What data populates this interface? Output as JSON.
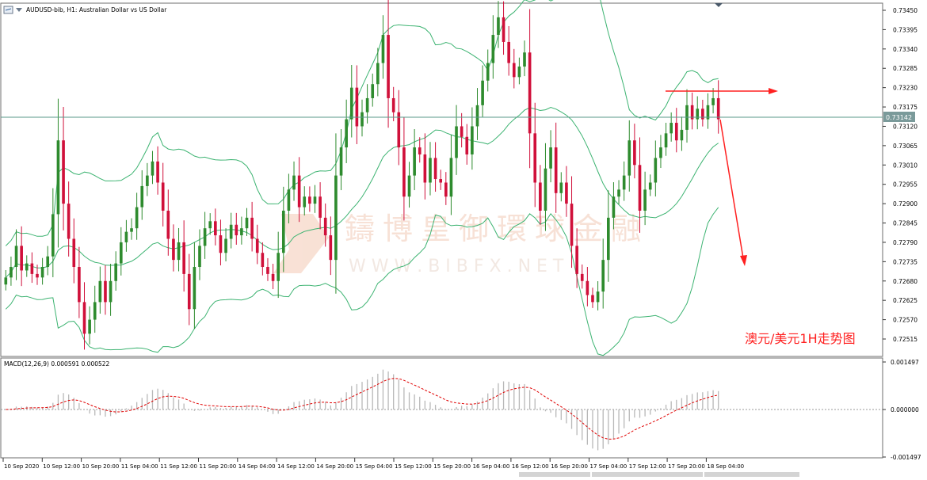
{
  "colors": {
    "bull": "#2e8b2e",
    "bear": "#d0103a",
    "band": "#3cb371",
    "macd_hist": "#b8b8b8",
    "signal": "#e00000",
    "arrow": "#ff2020",
    "price_line": "#5a9a8a",
    "grid_text": "#000000",
    "watermark": "#f3d6c8"
  },
  "header": {
    "title": "AUDUSD-bib, H1:  Australian Dollar vs US Dollar"
  },
  "macd_label": "MACD(12,26,9) 0.000591 0.000522",
  "current_price": "0.73142",
  "annotation": "澳元/美元1H走势图",
  "watermark": {
    "cn": "鑄博皇御環球金融",
    "en": "W W W . B I B F X . N E T"
  },
  "chart_data": [
    {
      "type": "candlestick",
      "title": "AUDUSD-bib, H1:  Australian Dollar vs US Dollar",
      "ylim": [
        0.72475,
        0.7347
      ],
      "yticks": [
        "0.73450",
        "0.73395",
        "0.73340",
        "0.73285",
        "0.73230",
        "0.73175",
        "0.73120",
        "0.73065",
        "0.73010",
        "0.72955",
        "0.72900",
        "0.72845",
        "0.72790",
        "0.72735",
        "0.72680",
        "0.72625",
        "0.72570",
        "0.72515"
      ],
      "xtick_labels": [
        "10 Sep 2020",
        "10 Sep 12:00",
        "10 Sep 20:00",
        "11 Sep 04:00",
        "11 Sep 12:00",
        "11 Sep 20:00",
        "14 Sep 04:00",
        "14 Sep 12:00",
        "14 Sep 20:00",
        "15 Sep 04:00",
        "15 Sep 12:00",
        "15 Sep 20:00",
        "16 Sep 04:00",
        "16 Sep 12:00",
        "16 Sep 20:00",
        "17 Sep 04:00",
        "17 Sep 12:00",
        "17 Sep 20:00",
        "18 Sep 04:00"
      ],
      "close": [
        0.7269,
        0.7272,
        0.7278,
        0.7271,
        0.7273,
        0.727,
        0.7269,
        0.7272,
        0.7275,
        0.7287,
        0.7308,
        0.729,
        0.728,
        0.7272,
        0.7262,
        0.7253,
        0.7257,
        0.7262,
        0.7268,
        0.7262,
        0.7268,
        0.7273,
        0.7279,
        0.7282,
        0.7283,
        0.7289,
        0.7295,
        0.7298,
        0.7302,
        0.7296,
        0.7288,
        0.728,
        0.7274,
        0.7279,
        0.727,
        0.726,
        0.7272,
        0.7278,
        0.7283,
        0.7285,
        0.7281,
        0.7276,
        0.728,
        0.7284,
        0.7281,
        0.7283,
        0.7286,
        0.728,
        0.7276,
        0.7272,
        0.727,
        0.7268,
        0.7276,
        0.7288,
        0.7294,
        0.7298,
        0.7289,
        0.7292,
        0.729,
        0.7292,
        0.7286,
        0.7281,
        0.7274,
        0.7298,
        0.7306,
        0.7314,
        0.7323,
        0.7312,
        0.7316,
        0.732,
        0.7324,
        0.733,
        0.7338,
        0.732,
        0.7316,
        0.7306,
        0.7292,
        0.7298,
        0.7306,
        0.7304,
        0.7296,
        0.7303,
        0.7297,
        0.7296,
        0.7292,
        0.7303,
        0.7312,
        0.7309,
        0.7304,
        0.7312,
        0.7318,
        0.7325,
        0.733,
        0.7338,
        0.7343,
        0.7336,
        0.733,
        0.7326,
        0.7329,
        0.7333,
        0.731,
        0.7296,
        0.7288,
        0.73,
        0.7306,
        0.7293,
        0.7296,
        0.729,
        0.7278,
        0.727,
        0.7268,
        0.7264,
        0.7262,
        0.7265,
        0.7274,
        0.7286,
        0.7292,
        0.7294,
        0.7298,
        0.7308,
        0.7301,
        0.7288,
        0.7294,
        0.7296,
        0.7303,
        0.7306,
        0.731,
        0.7313,
        0.7308,
        0.7311,
        0.7318,
        0.7314,
        0.7317,
        0.7314,
        0.7318,
        0.732,
        0.7314
      ],
      "open_rule": "each candle opens at the previous candle's close"
    },
    {
      "type": "line",
      "title": "MACD(12,26,9) 0.000591 0.000522",
      "ylim": [
        -0.001497,
        0.001497
      ],
      "yticks": [
        "0.001497",
        "0.000000",
        "-0.001497"
      ],
      "series_values": {
        "macd_histogram": "computed: EMA12 - EMA26 of close",
        "signal": "computed: EMA9 of MACD"
      }
    }
  ]
}
